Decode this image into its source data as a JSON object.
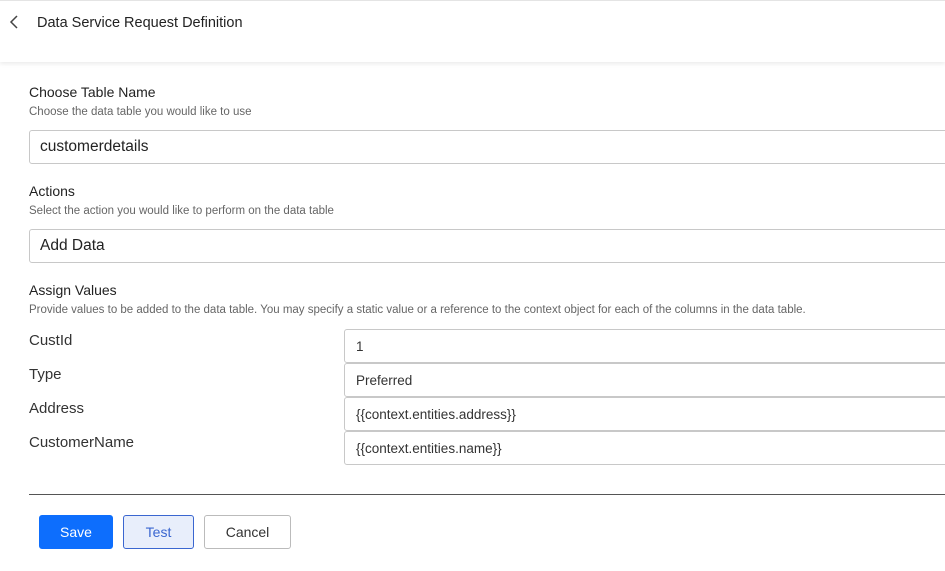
{
  "header": {
    "title": "Data Service Request Definition"
  },
  "table": {
    "label": "Choose Table Name",
    "help": "Choose the data table you would like to use",
    "value": "customerdetails"
  },
  "actions": {
    "label": "Actions",
    "help": "Select the action you would like to perform on the data table",
    "value": "Add Data"
  },
  "assign": {
    "label": "Assign Values",
    "help": "Provide values to be added to the data table. You may specify a static value or a reference to the context object for each of the columns in the data table.",
    "rows": [
      {
        "column": "CustId",
        "value": "1"
      },
      {
        "column": "Type",
        "value": "Preferred"
      },
      {
        "column": "Address",
        "value": "{{context.entities.address}}"
      },
      {
        "column": "CustomerName",
        "value": "{{context.entities.name}}"
      }
    ]
  },
  "buttons": {
    "save": "Save",
    "test": "Test",
    "cancel": "Cancel"
  },
  "colors": {
    "primary": "#0d6efd",
    "test": "#3a66d0"
  }
}
